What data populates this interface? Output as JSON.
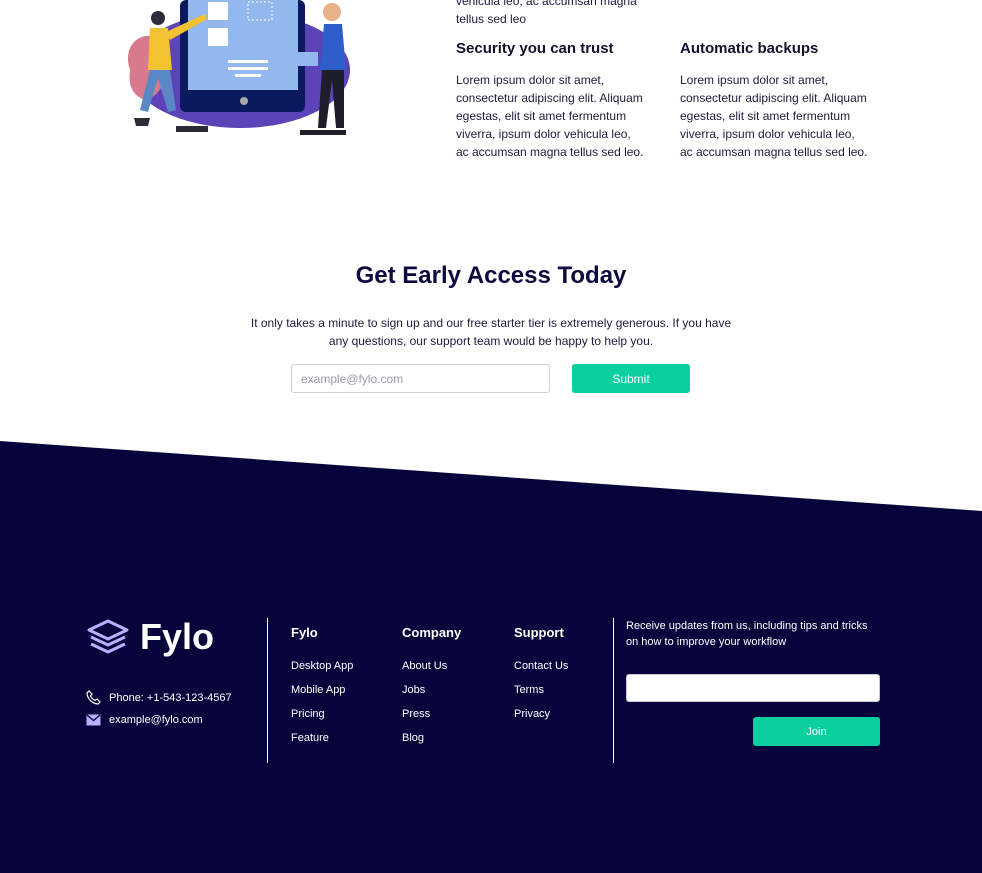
{
  "features": {
    "top_text": "vehicula leo, ac accumsan magna tellus sed leo",
    "items": [
      {
        "title": "Security you can trust",
        "body": "Lorem ipsum dolor sit amet, consectetur adipiscing elit. Aliquam egestas, elit sit amet fermentum viverra, ipsum dolor vehicula leo, ac accumsan magna tellus sed leo."
      },
      {
        "title": "Automatic backups",
        "body": "Lorem ipsum dolor sit amet, consectetur adipiscing elit. Aliquam egestas, elit sit amet fermentum viverra, ipsum dolor vehicula leo, ac accumsan magna tellus sed leo."
      }
    ]
  },
  "early_access": {
    "title": "Get Early Access Today",
    "description": "It only takes a minute to sign up and our free starter tier is extremely generous. If you have any questions, our support team would be happy to help you.",
    "email_placeholder": "example@fylo.com",
    "submit_label": "Submit"
  },
  "footer": {
    "brand": "Fylo",
    "phone": "Phone: +1-543-123-4567",
    "email": "example@fylo.com",
    "columns": [
      {
        "title": "Fylo",
        "links": [
          "Desktop App",
          "Mobile App",
          "Pricing",
          "Feature"
        ]
      },
      {
        "title": "Company",
        "links": [
          "About Us",
          "Jobs",
          "Press",
          "Blog"
        ]
      },
      {
        "title": "Support",
        "links": [
          "Contact Us",
          "Terms",
          "Privacy"
        ]
      }
    ],
    "newsletter_text": "Receive updates from us, including tips and tricks on how to improve your workflow",
    "newsletter_value": "",
    "join_label": "Join"
  },
  "colors": {
    "footer_bg": "#07043b",
    "accent": "#0ad0a0",
    "heading": "#0c0a3e"
  }
}
